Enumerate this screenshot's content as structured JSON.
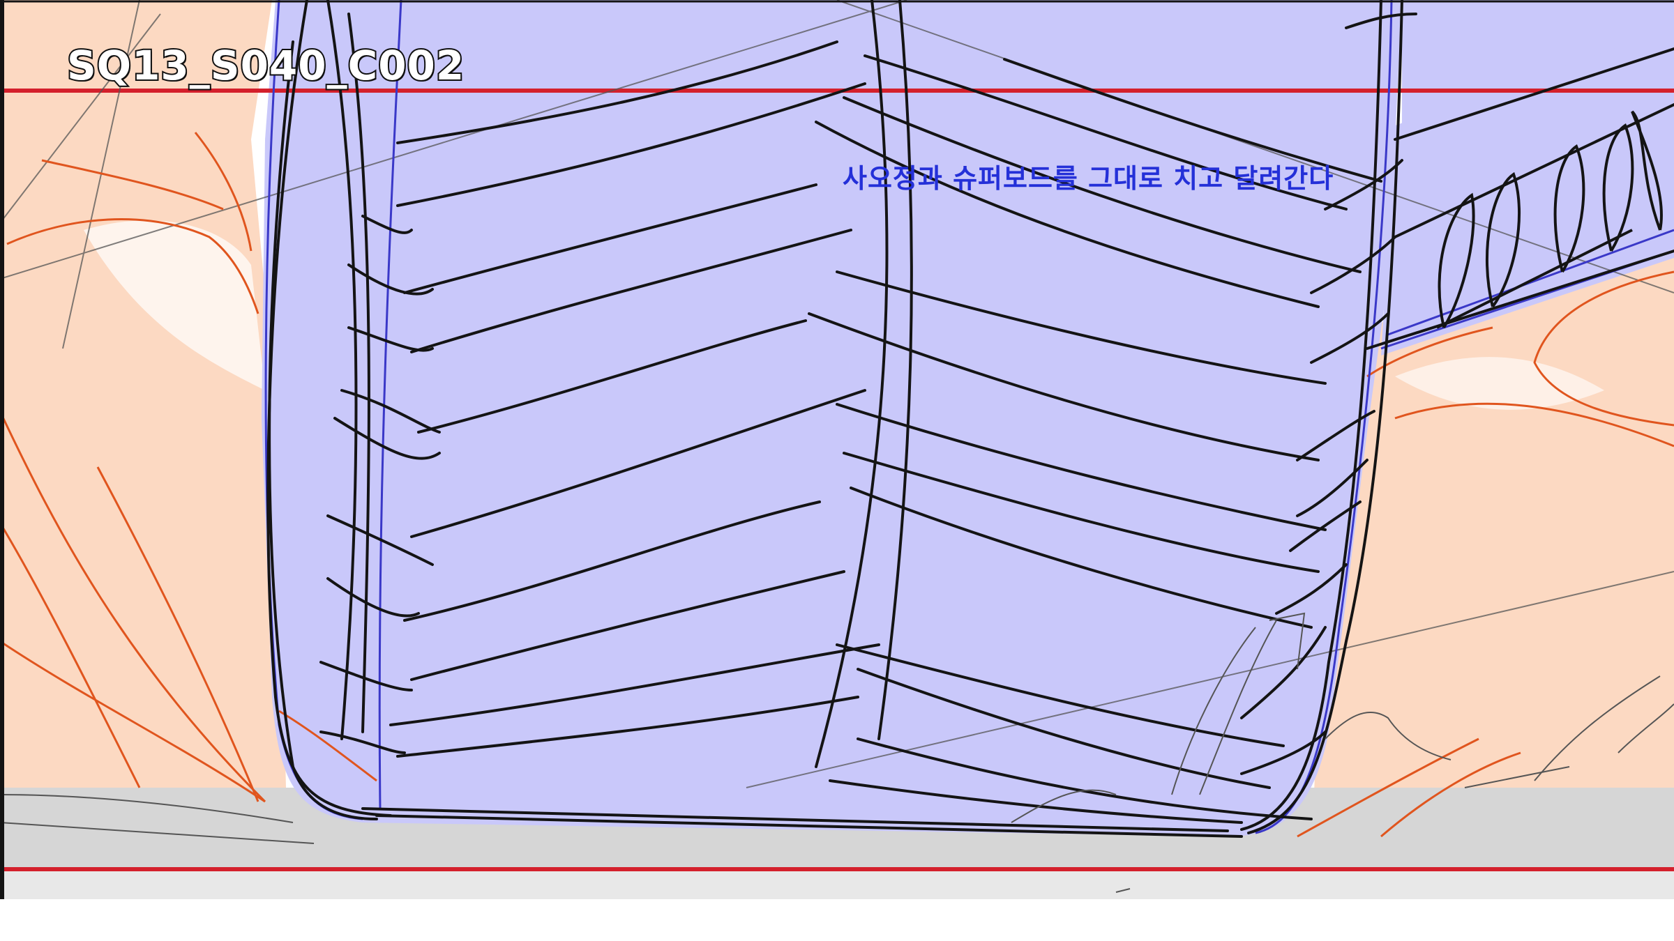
{
  "shot": {
    "code": "SQ13_S040_C002",
    "note": "사오정과 슈퍼보드를 그대로 치고 달려간다"
  },
  "colors": {
    "skin": "#fcd9c2",
    "board": "#c9c8fa",
    "frame_line": "#d4202c",
    "ink": "#141414",
    "blue_line": "#3a38c8",
    "orange_line": "#e0551e",
    "ground": "#d6d6d6",
    "note_text": "#2430d8"
  }
}
